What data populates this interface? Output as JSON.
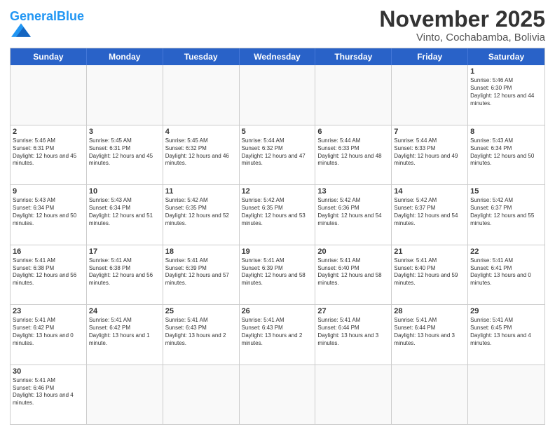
{
  "header": {
    "logo_general": "General",
    "logo_blue": "Blue",
    "month_title": "November 2025",
    "location": "Vinto, Cochabamba, Bolivia"
  },
  "days_of_week": [
    "Sunday",
    "Monday",
    "Tuesday",
    "Wednesday",
    "Thursday",
    "Friday",
    "Saturday"
  ],
  "weeks": [
    [
      {
        "day": "",
        "empty": true
      },
      {
        "day": "",
        "empty": true
      },
      {
        "day": "",
        "empty": true
      },
      {
        "day": "",
        "empty": true
      },
      {
        "day": "",
        "empty": true
      },
      {
        "day": "",
        "empty": true
      },
      {
        "day": "1",
        "sunrise": "5:46 AM",
        "sunset": "6:30 PM",
        "daylight": "12 hours and 44 minutes."
      }
    ],
    [
      {
        "day": "2",
        "sunrise": "5:46 AM",
        "sunset": "6:31 PM",
        "daylight": "12 hours and 45 minutes."
      },
      {
        "day": "3",
        "sunrise": "5:45 AM",
        "sunset": "6:31 PM",
        "daylight": "12 hours and 45 minutes."
      },
      {
        "day": "4",
        "sunrise": "5:45 AM",
        "sunset": "6:32 PM",
        "daylight": "12 hours and 46 minutes."
      },
      {
        "day": "5",
        "sunrise": "5:44 AM",
        "sunset": "6:32 PM",
        "daylight": "12 hours and 47 minutes."
      },
      {
        "day": "6",
        "sunrise": "5:44 AM",
        "sunset": "6:33 PM",
        "daylight": "12 hours and 48 minutes."
      },
      {
        "day": "7",
        "sunrise": "5:44 AM",
        "sunset": "6:33 PM",
        "daylight": "12 hours and 49 minutes."
      },
      {
        "day": "8",
        "sunrise": "5:43 AM",
        "sunset": "6:34 PM",
        "daylight": "12 hours and 50 minutes."
      }
    ],
    [
      {
        "day": "9",
        "sunrise": "5:43 AM",
        "sunset": "6:34 PM",
        "daylight": "12 hours and 50 minutes."
      },
      {
        "day": "10",
        "sunrise": "5:43 AM",
        "sunset": "6:34 PM",
        "daylight": "12 hours and 51 minutes."
      },
      {
        "day": "11",
        "sunrise": "5:42 AM",
        "sunset": "6:35 PM",
        "daylight": "12 hours and 52 minutes."
      },
      {
        "day": "12",
        "sunrise": "5:42 AM",
        "sunset": "6:35 PM",
        "daylight": "12 hours and 53 minutes."
      },
      {
        "day": "13",
        "sunrise": "5:42 AM",
        "sunset": "6:36 PM",
        "daylight": "12 hours and 54 minutes."
      },
      {
        "day": "14",
        "sunrise": "5:42 AM",
        "sunset": "6:37 PM",
        "daylight": "12 hours and 54 minutes."
      },
      {
        "day": "15",
        "sunrise": "5:42 AM",
        "sunset": "6:37 PM",
        "daylight": "12 hours and 55 minutes."
      }
    ],
    [
      {
        "day": "16",
        "sunrise": "5:41 AM",
        "sunset": "6:38 PM",
        "daylight": "12 hours and 56 minutes."
      },
      {
        "day": "17",
        "sunrise": "5:41 AM",
        "sunset": "6:38 PM",
        "daylight": "12 hours and 56 minutes."
      },
      {
        "day": "18",
        "sunrise": "5:41 AM",
        "sunset": "6:39 PM",
        "daylight": "12 hours and 57 minutes."
      },
      {
        "day": "19",
        "sunrise": "5:41 AM",
        "sunset": "6:39 PM",
        "daylight": "12 hours and 58 minutes."
      },
      {
        "day": "20",
        "sunrise": "5:41 AM",
        "sunset": "6:40 PM",
        "daylight": "12 hours and 58 minutes."
      },
      {
        "day": "21",
        "sunrise": "5:41 AM",
        "sunset": "6:40 PM",
        "daylight": "12 hours and 59 minutes."
      },
      {
        "day": "22",
        "sunrise": "5:41 AM",
        "sunset": "6:41 PM",
        "daylight": "13 hours and 0 minutes."
      }
    ],
    [
      {
        "day": "23",
        "sunrise": "5:41 AM",
        "sunset": "6:42 PM",
        "daylight": "13 hours and 0 minutes."
      },
      {
        "day": "24",
        "sunrise": "5:41 AM",
        "sunset": "6:42 PM",
        "daylight": "13 hours and 1 minute."
      },
      {
        "day": "25",
        "sunrise": "5:41 AM",
        "sunset": "6:43 PM",
        "daylight": "13 hours and 2 minutes."
      },
      {
        "day": "26",
        "sunrise": "5:41 AM",
        "sunset": "6:43 PM",
        "daylight": "13 hours and 2 minutes."
      },
      {
        "day": "27",
        "sunrise": "5:41 AM",
        "sunset": "6:44 PM",
        "daylight": "13 hours and 3 minutes."
      },
      {
        "day": "28",
        "sunrise": "5:41 AM",
        "sunset": "6:44 PM",
        "daylight": "13 hours and 3 minutes."
      },
      {
        "day": "29",
        "sunrise": "5:41 AM",
        "sunset": "6:45 PM",
        "daylight": "13 hours and 4 minutes."
      }
    ],
    [
      {
        "day": "30",
        "sunrise": "5:41 AM",
        "sunset": "6:46 PM",
        "daylight": "13 hours and 4 minutes."
      },
      {
        "day": "",
        "empty": true
      },
      {
        "day": "",
        "empty": true
      },
      {
        "day": "",
        "empty": true
      },
      {
        "day": "",
        "empty": true
      },
      {
        "day": "",
        "empty": true
      },
      {
        "day": "",
        "empty": true
      }
    ]
  ]
}
